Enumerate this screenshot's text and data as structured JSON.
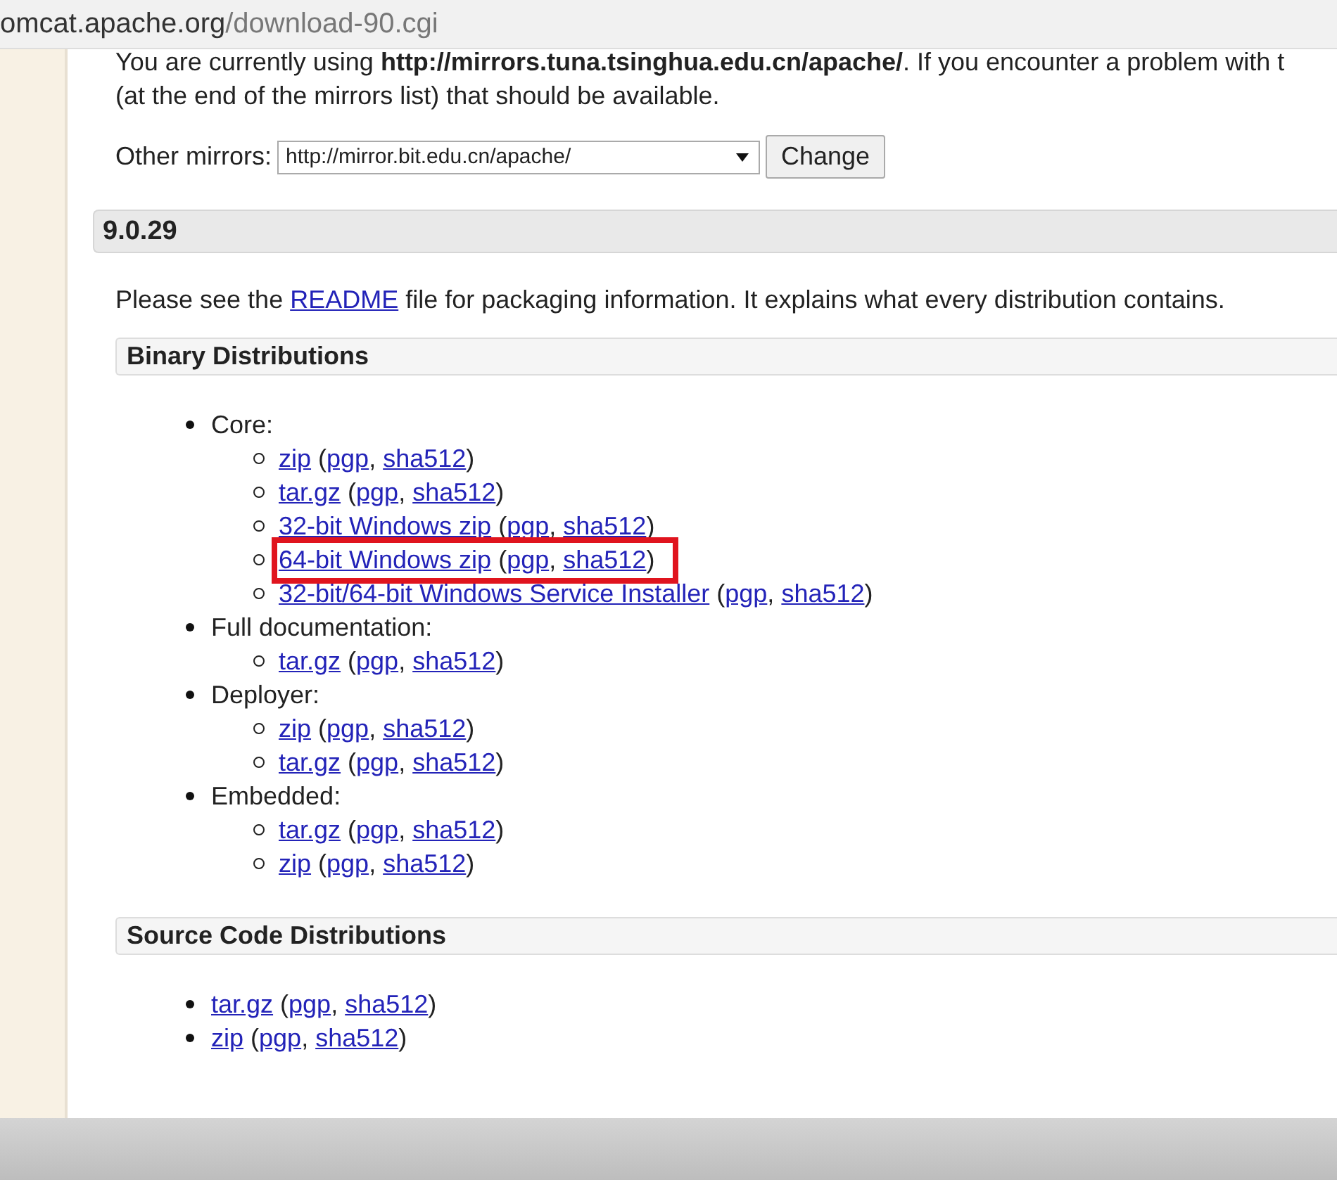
{
  "address_bar": {
    "host": "omcat.apache.org",
    "path": "/download-90.cgi"
  },
  "mirror_notice": {
    "line_1": "You are currently using **http://mirrors.tuna.tsinghua.edu.cn/apache/**. If you encounter a problem with t",
    "line_2": "(at the end of the mirrors list) that should be available."
  },
  "other_mirrors": {
    "label": "Other mirrors:",
    "value": "http://mirror.bit.edu.cn/apache/",
    "button": "Change"
  },
  "version_heading": "9.0.29",
  "readme": {
    "before": "Please see the ",
    "link": "README",
    "after": " file for packaging information. It explains what every distribution contains."
  },
  "sections": [
    {
      "title": "Binary Distributions",
      "groups": [
        {
          "label": "Core:",
          "items": [
            {
              "links": [
                "zip",
                "pgp",
                "sha512"
              ],
              "separators": [
                " (",
                ", ",
                ")"
              ],
              "highlighted": false
            },
            {
              "links": [
                "tar.gz",
                "pgp",
                "sha512"
              ],
              "separators": [
                " (",
                ", ",
                ")"
              ],
              "highlighted": false
            },
            {
              "links": [
                "32-bit Windows zip",
                "pgp",
                "sha512"
              ],
              "separators": [
                " (",
                ", ",
                ")"
              ],
              "highlighted": false
            },
            {
              "links": [
                "64-bit Windows zip",
                "pgp",
                "sha512"
              ],
              "separators": [
                " (",
                ", ",
                ")"
              ],
              "highlighted": true
            },
            {
              "links": [
                "32-bit/64-bit Windows Service Installer",
                "pgp",
                "sha512"
              ],
              "separators": [
                " (",
                ", ",
                ")"
              ],
              "highlighted": false
            }
          ]
        },
        {
          "label": "Full documentation:",
          "items": [
            {
              "links": [
                "tar.gz",
                "pgp",
                "sha512"
              ],
              "separators": [
                " (",
                ", ",
                ")"
              ],
              "highlighted": false
            }
          ]
        },
        {
          "label": "Deployer:",
          "items": [
            {
              "links": [
                "zip",
                "pgp",
                "sha512"
              ],
              "separators": [
                " (",
                ", ",
                ")"
              ],
              "highlighted": false
            },
            {
              "links": [
                "tar.gz",
                "pgp",
                "sha512"
              ],
              "separators": [
                " (",
                ", ",
                ")"
              ],
              "highlighted": false
            }
          ]
        },
        {
          "label": "Embedded:",
          "items": [
            {
              "links": [
                "tar.gz",
                "pgp",
                "sha512"
              ],
              "separators": [
                " (",
                ", ",
                ")"
              ],
              "highlighted": false
            },
            {
              "links": [
                "zip",
                "pgp",
                "sha512"
              ],
              "separators": [
                " (",
                ", ",
                ")"
              ],
              "highlighted": false
            }
          ]
        }
      ]
    },
    {
      "title": "Source Code Distributions",
      "items": [
        {
          "links": [
            "tar.gz",
            "pgp",
            "sha512"
          ],
          "separators": [
            " (",
            ", ",
            ")"
          ],
          "highlighted": false
        },
        {
          "links": [
            "zip",
            "pgp",
            "sha512"
          ],
          "separators": [
            " (",
            ", ",
            ")"
          ],
          "highlighted": false
        }
      ]
    }
  ]
}
